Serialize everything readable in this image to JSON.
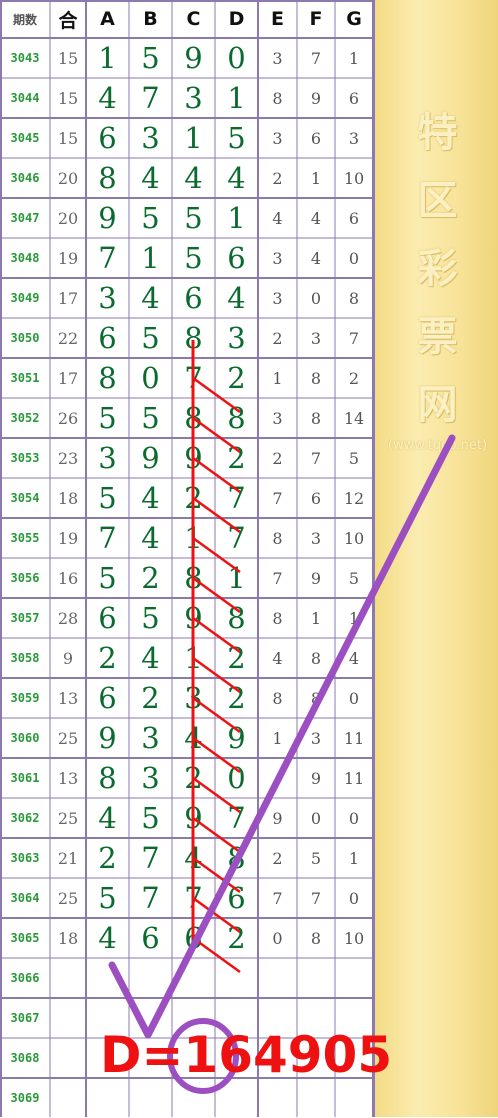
{
  "headers": [
    "期数",
    "合",
    "A",
    "B",
    "C",
    "D",
    "E",
    "F",
    "G"
  ],
  "rows": [
    {
      "period": "3043",
      "sum": "15",
      "a": "1",
      "b": "5",
      "c": "9",
      "d": "0",
      "e": "3",
      "f": "7",
      "g": "1"
    },
    {
      "period": "3044",
      "sum": "15",
      "a": "4",
      "b": "7",
      "c": "3",
      "d": "1",
      "e": "8",
      "f": "9",
      "g": "6"
    },
    {
      "period": "3045",
      "sum": "15",
      "a": "6",
      "b": "3",
      "c": "1",
      "d": "5",
      "e": "3",
      "f": "6",
      "g": "3"
    },
    {
      "period": "3046",
      "sum": "20",
      "a": "8",
      "b": "4",
      "c": "4",
      "d": "4",
      "e": "2",
      "f": "1",
      "g": "10"
    },
    {
      "period": "3047",
      "sum": "20",
      "a": "9",
      "b": "5",
      "c": "5",
      "d": "1",
      "e": "4",
      "f": "4",
      "g": "6"
    },
    {
      "period": "3048",
      "sum": "19",
      "a": "7",
      "b": "1",
      "c": "5",
      "d": "6",
      "e": "3",
      "f": "4",
      "g": "0"
    },
    {
      "period": "3049",
      "sum": "17",
      "a": "3",
      "b": "4",
      "c": "6",
      "d": "4",
      "e": "3",
      "f": "0",
      "g": "8"
    },
    {
      "period": "3050",
      "sum": "22",
      "a": "6",
      "b": "5",
      "c": "8",
      "d": "3",
      "e": "2",
      "f": "3",
      "g": "7"
    },
    {
      "period": "3051",
      "sum": "17",
      "a": "8",
      "b": "0",
      "c": "7",
      "d": "2",
      "e": "1",
      "f": "8",
      "g": "2"
    },
    {
      "period": "3052",
      "sum": "26",
      "a": "5",
      "b": "5",
      "c": "8",
      "d": "8",
      "e": "3",
      "f": "8",
      "g": "14"
    },
    {
      "period": "3053",
      "sum": "23",
      "a": "3",
      "b": "9",
      "c": "9",
      "d": "2",
      "e": "2",
      "f": "7",
      "g": "5"
    },
    {
      "period": "3054",
      "sum": "18",
      "a": "5",
      "b": "4",
      "c": "2",
      "d": "7",
      "e": "7",
      "f": "6",
      "g": "12"
    },
    {
      "period": "3055",
      "sum": "19",
      "a": "7",
      "b": "4",
      "c": "1",
      "d": "7",
      "e": "8",
      "f": "3",
      "g": "10"
    },
    {
      "period": "3056",
      "sum": "16",
      "a": "5",
      "b": "2",
      "c": "8",
      "d": "1",
      "e": "7",
      "f": "9",
      "g": "5"
    },
    {
      "period": "3057",
      "sum": "28",
      "a": "6",
      "b": "5",
      "c": "9",
      "d": "8",
      "e": "8",
      "f": "1",
      "g": "1"
    },
    {
      "period": "3058",
      "sum": "9",
      "a": "2",
      "b": "4",
      "c": "1",
      "d": "2",
      "e": "4",
      "f": "8",
      "g": "4"
    },
    {
      "period": "3059",
      "sum": "13",
      "a": "6",
      "b": "2",
      "c": "3",
      "d": "2",
      "e": "8",
      "f": "8",
      "g": "0"
    },
    {
      "period": "3060",
      "sum": "25",
      "a": "9",
      "b": "3",
      "c": "4",
      "d": "9",
      "e": "1",
      "f": "3",
      "g": "11"
    },
    {
      "period": "3061",
      "sum": "13",
      "a": "8",
      "b": "3",
      "c": "2",
      "d": "0",
      "e": "",
      "f": "9",
      "g": "11"
    },
    {
      "period": "3062",
      "sum": "25",
      "a": "4",
      "b": "5",
      "c": "9",
      "d": "7",
      "e": "9",
      "f": "0",
      "g": "0"
    },
    {
      "period": "3063",
      "sum": "21",
      "a": "2",
      "b": "7",
      "c": "4",
      "d": "8",
      "e": "2",
      "f": "5",
      "g": "1"
    },
    {
      "period": "3064",
      "sum": "25",
      "a": "5",
      "b": "7",
      "c": "7",
      "d": "6",
      "e": "7",
      "f": "7",
      "g": "0"
    },
    {
      "period": "3065",
      "sum": "18",
      "a": "4",
      "b": "6",
      "c": "6",
      "d": "2",
      "e": "0",
      "f": "8",
      "g": "10"
    },
    {
      "period": "3066",
      "sum": "",
      "a": "",
      "b": "",
      "c": "",
      "d": "",
      "e": "",
      "f": "",
      "g": ""
    },
    {
      "period": "3067",
      "sum": "",
      "a": "",
      "b": "",
      "c": "",
      "d": "",
      "e": "",
      "f": "",
      "g": ""
    },
    {
      "period": "3068",
      "sum": "",
      "a": "",
      "b": "",
      "c": "",
      "d": "",
      "e": "",
      "f": "",
      "g": ""
    },
    {
      "period": "3069",
      "sum": "",
      "a": "",
      "b": "",
      "c": "",
      "d": "",
      "e": "",
      "f": "",
      "g": ""
    }
  ],
  "watermark": {
    "characters": [
      "特",
      "区",
      "彩",
      "票",
      "网"
    ],
    "url": "(www.tqcp.net)"
  },
  "annotation": {
    "formula": "D=164905"
  },
  "colors": {
    "grid_line": "#8a7ab0",
    "period_text": "#2a9a3a",
    "big_digit": "#0b6b2e",
    "red_mark": "#ee1111",
    "purple_mark": "#9b4fc0",
    "side_panel": "#f7e297"
  }
}
